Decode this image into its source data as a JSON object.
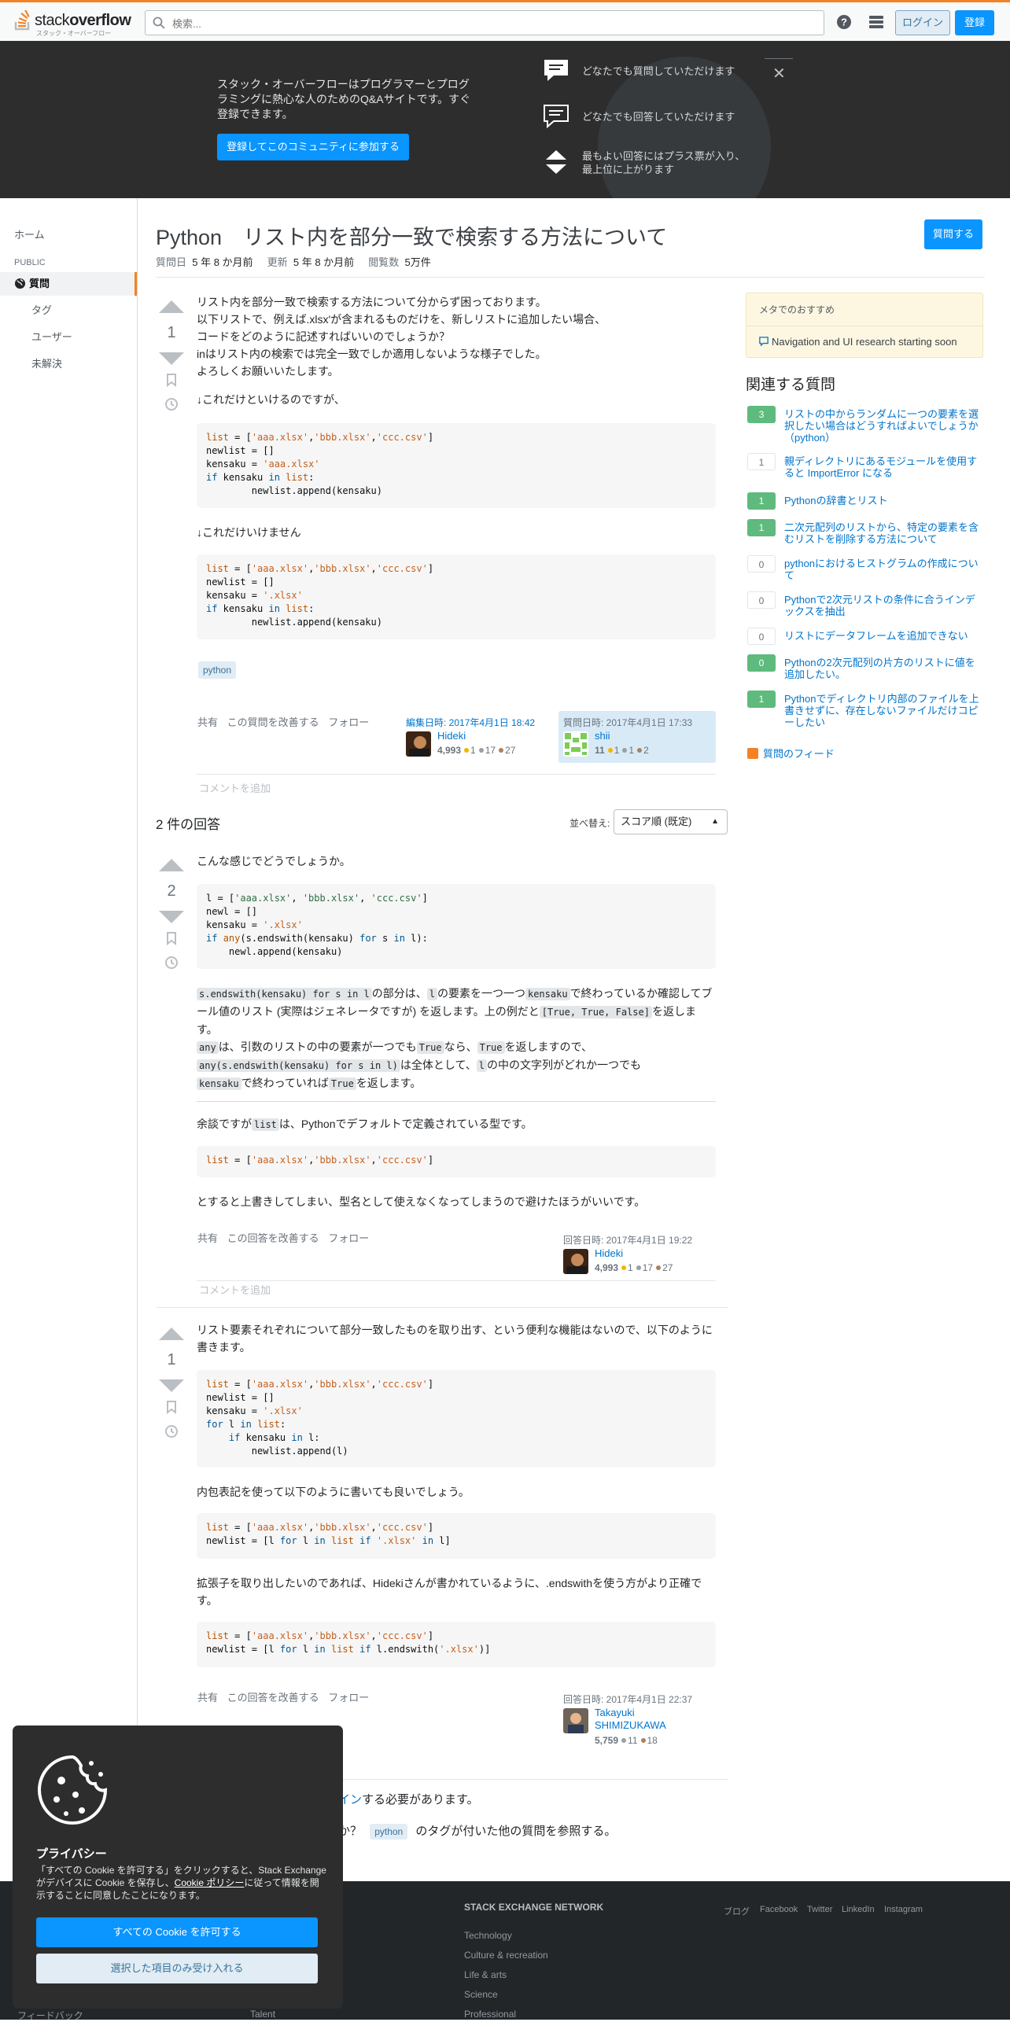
{
  "header": {
    "logo_text_a": "stack",
    "logo_text_b": "overflow",
    "logo_sub": "スタック・オーバーフロー",
    "search_placeholder": "検索...",
    "login": "ログイン",
    "signup": "登録"
  },
  "hero": {
    "text": "スタック・オーバーフローはプログラマーとプログラミングに熱心な人のためのQ&Aサイトです。すぐ登録できます。",
    "button": "登録してこのコミュニティに参加する",
    "features": [
      "どなたでも質問していただけます",
      "どなたでも回答していただけます",
      "最もよい回答にはプラス票が入り、最上位に上がります"
    ]
  },
  "nav": {
    "home": "ホーム",
    "public": "PUBLIC",
    "questions": "質問",
    "tags": "タグ",
    "users": "ユーザー",
    "unanswered": "未解決"
  },
  "question": {
    "title": "Python　リスト内を部分一致で検索する方法について",
    "asked_label": "質問日",
    "asked_value": "5 年 8 か月前",
    "modified_label": "更新",
    "modified_value": "5 年 8 か月前",
    "viewed_label": "閲覧数",
    "viewed_value": "5万件",
    "ask_button": "質問する",
    "votes": "1",
    "body": [
      "リスト内を部分一致で検索する方法について分からず困っております。",
      "以下リストで、例えば.xlsx'が含まれるものだけを、新しリストに追加したい場合、",
      "コードをどのように記述すればいいのでしょうか？",
      "inはリスト内の検索では完全一致でしか適用しないような様子でした。",
      "よろしくお願いいたします。"
    ],
    "works_label": "↓これだけといけるのですが、",
    "fails_label": "↓これだけいけません",
    "tag": "python",
    "menu": [
      "共有",
      "この質問を改善する",
      "フォロー"
    ],
    "edited": {
      "ts": "編集日時: 2017年4月1日 18:42",
      "name": "Hideki",
      "rep": "4,993",
      "gold": "1",
      "silver": "17",
      "bronze": "27"
    },
    "asked_card": {
      "ts": "質問日時: 2017年4月1日 17:33",
      "name": "shii",
      "rep": "11",
      "gold": "1",
      "silver": "1",
      "bronze": "2"
    },
    "add_comment": "コメントを追加"
  },
  "sidebar": {
    "meta_header": "メタでのおすすめ",
    "meta_item": "Navigation and UI research starting soon",
    "related_title": "関連する質問",
    "related": [
      {
        "score": "3",
        "text": "リストの中からランダムに一つの要素を選択したい場合はどうすればよいでしょうか（python）",
        "pos": true
      },
      {
        "score": "1",
        "text": "親ディレクトリにあるモジュールを使用すると ImportError になる",
        "pos": false
      },
      {
        "score": "1",
        "text": "Pythonの辞書とリスト",
        "pos": true
      },
      {
        "score": "1",
        "text": "二次元配列のリストから、特定の要素を含むリストを削除する方法について",
        "pos": true
      },
      {
        "score": "0",
        "text": "pythonにおけるヒストグラムの作成について",
        "pos": false
      },
      {
        "score": "0",
        "text": "Pythonで2次元リストの条件に合うインデックスを抽出",
        "pos": false
      },
      {
        "score": "0",
        "text": "リストにデータフレームを追加できない",
        "pos": false
      },
      {
        "score": "0",
        "text": "Pythonの2次元配列の片方のリストに値を追加したい。",
        "pos": true
      },
      {
        "score": "1",
        "text": "Pythonでディレクトリ内部のファイルを上書きせずに、存在しないファイルだけコピーしたい",
        "pos": true
      }
    ],
    "feed": "質問のフィード"
  },
  "answers": {
    "count_title": "2 件の回答",
    "sort_label": "並べ替え:",
    "sort_value": "スコア順 (既定)",
    "a1": {
      "votes": "2",
      "intro": "こんな感じでどうでしょうか。",
      "exp1a": "の部分は、",
      "exp1b": "の要素を一つ一つ",
      "exp1c": "で終わっているか確認してブール値のリスト (実際はジェネレータですが) を返します。上の例だと",
      "exp1d": "を返します。",
      "exp2a": "は、引数のリストの中の要素が一つでも",
      "exp2b": "なら、",
      "exp2c": "を返しますので、",
      "exp3a": "は全体として、",
      "exp3b": "の中の文字列がどれか一つでも",
      "exp3c": "で終わっていれば",
      "exp3d": "を返します。",
      "code_sendswith": "s.endswith(kensaku) for s in l",
      "code_l": "l",
      "code_kensaku": "kensaku",
      "code_tf": "[True, True, False]",
      "code_any": "any",
      "code_true": "True",
      "code_anyfull": "any(s.endswith(kensaku) for s in l)",
      "aside_a": "余談ですが",
      "aside_code": "list",
      "aside_b": "は、Pythonでデフォルトで定義されている型です。",
      "aside2": "とすると上書きしてしまい、型名として使えなくなってしまうので避けたほうがいいです。",
      "menu": [
        "共有",
        "この回答を改善する",
        "フォロー"
      ],
      "card": {
        "ts": "回答日時: 2017年4月1日 19:22",
        "name": "Hideki",
        "rep": "4,993",
        "gold": "1",
        "silver": "17",
        "bronze": "27"
      },
      "add_comment": "コメントを追加"
    },
    "a2": {
      "votes": "1",
      "intro": "リスト要素それぞれについて部分一致したものを取り出す、という便利な機能はないので、以下のように書きます。",
      "mid": "内包表記を使って以下のように書いても良いでしょう。",
      "mid2": "拡張子を取り出したいのであれば、Hidekiさんが書かれているように、.endswithを使う方がより正確です。",
      "menu": [
        "共有",
        "この回答を改善する",
        "フォロー"
      ],
      "card": {
        "ts": "回答日時: 2017年4月1日 22:37",
        "name": "Takayuki SHIMIZUKAWA",
        "rep": "5,759",
        "gold": "",
        "silver": "11",
        "bronze": "18"
      }
    },
    "login_note_link": "イン",
    "login_note_rest": "する必要があります。",
    "browse_a": "か？",
    "browse_tag": "python",
    "browse_b": "のタグが付いた他の質問を参照する。"
  },
  "cookie": {
    "title": "プライバシー",
    "text_a": "「すべての Cookie を許可する」をクリックすると、Stack Exchange がデバイスに Cookie を保存し、",
    "link": "Cookie ポリシー",
    "text_b": "に従って情報を開示することに同意したことになります。",
    "accept_all": "すべての Cookie を許可する",
    "accept_selected": "選択した項目のみ受け入れる"
  },
  "footer": {
    "network_title": "STACK EXCHANGE NETWORK",
    "network": [
      "Technology",
      "Culture & recreation",
      "Life & arts",
      "Science",
      "Professional"
    ],
    "social": [
      "ブログ",
      "Facebook",
      "Twitter",
      "LinkedIn",
      "Instagram"
    ],
    "left_links": [
      "フィードバック"
    ],
    "mid_links": [
      "Talent"
    ]
  },
  "colors": {
    "accent": "#f48225",
    "primary": "#0a95ff",
    "hero_bg": "#2d2d2d",
    "footer_bg": "#232629"
  }
}
